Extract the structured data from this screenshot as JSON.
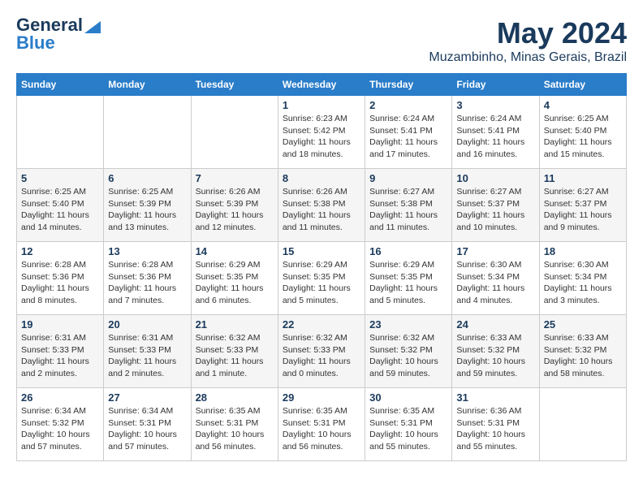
{
  "logo": {
    "general": "General",
    "blue": "Blue"
  },
  "title": "May 2024",
  "location": "Muzambinho, Minas Gerais, Brazil",
  "days_of_week": [
    "Sunday",
    "Monday",
    "Tuesday",
    "Wednesday",
    "Thursday",
    "Friday",
    "Saturday"
  ],
  "weeks": [
    [
      {
        "day": "",
        "info": ""
      },
      {
        "day": "",
        "info": ""
      },
      {
        "day": "",
        "info": ""
      },
      {
        "day": "1",
        "info": "Sunrise: 6:23 AM\nSunset: 5:42 PM\nDaylight: 11 hours and 18 minutes."
      },
      {
        "day": "2",
        "info": "Sunrise: 6:24 AM\nSunset: 5:41 PM\nDaylight: 11 hours and 17 minutes."
      },
      {
        "day": "3",
        "info": "Sunrise: 6:24 AM\nSunset: 5:41 PM\nDaylight: 11 hours and 16 minutes."
      },
      {
        "day": "4",
        "info": "Sunrise: 6:25 AM\nSunset: 5:40 PM\nDaylight: 11 hours and 15 minutes."
      }
    ],
    [
      {
        "day": "5",
        "info": "Sunrise: 6:25 AM\nSunset: 5:40 PM\nDaylight: 11 hours and 14 minutes."
      },
      {
        "day": "6",
        "info": "Sunrise: 6:25 AM\nSunset: 5:39 PM\nDaylight: 11 hours and 13 minutes."
      },
      {
        "day": "7",
        "info": "Sunrise: 6:26 AM\nSunset: 5:39 PM\nDaylight: 11 hours and 12 minutes."
      },
      {
        "day": "8",
        "info": "Sunrise: 6:26 AM\nSunset: 5:38 PM\nDaylight: 11 hours and 11 minutes."
      },
      {
        "day": "9",
        "info": "Sunrise: 6:27 AM\nSunset: 5:38 PM\nDaylight: 11 hours and 11 minutes."
      },
      {
        "day": "10",
        "info": "Sunrise: 6:27 AM\nSunset: 5:37 PM\nDaylight: 11 hours and 10 minutes."
      },
      {
        "day": "11",
        "info": "Sunrise: 6:27 AM\nSunset: 5:37 PM\nDaylight: 11 hours and 9 minutes."
      }
    ],
    [
      {
        "day": "12",
        "info": "Sunrise: 6:28 AM\nSunset: 5:36 PM\nDaylight: 11 hours and 8 minutes."
      },
      {
        "day": "13",
        "info": "Sunrise: 6:28 AM\nSunset: 5:36 PM\nDaylight: 11 hours and 7 minutes."
      },
      {
        "day": "14",
        "info": "Sunrise: 6:29 AM\nSunset: 5:35 PM\nDaylight: 11 hours and 6 minutes."
      },
      {
        "day": "15",
        "info": "Sunrise: 6:29 AM\nSunset: 5:35 PM\nDaylight: 11 hours and 5 minutes."
      },
      {
        "day": "16",
        "info": "Sunrise: 6:29 AM\nSunset: 5:35 PM\nDaylight: 11 hours and 5 minutes."
      },
      {
        "day": "17",
        "info": "Sunrise: 6:30 AM\nSunset: 5:34 PM\nDaylight: 11 hours and 4 minutes."
      },
      {
        "day": "18",
        "info": "Sunrise: 6:30 AM\nSunset: 5:34 PM\nDaylight: 11 hours and 3 minutes."
      }
    ],
    [
      {
        "day": "19",
        "info": "Sunrise: 6:31 AM\nSunset: 5:33 PM\nDaylight: 11 hours and 2 minutes."
      },
      {
        "day": "20",
        "info": "Sunrise: 6:31 AM\nSunset: 5:33 PM\nDaylight: 11 hours and 2 minutes."
      },
      {
        "day": "21",
        "info": "Sunrise: 6:32 AM\nSunset: 5:33 PM\nDaylight: 11 hours and 1 minute."
      },
      {
        "day": "22",
        "info": "Sunrise: 6:32 AM\nSunset: 5:33 PM\nDaylight: 11 hours and 0 minutes."
      },
      {
        "day": "23",
        "info": "Sunrise: 6:32 AM\nSunset: 5:32 PM\nDaylight: 10 hours and 59 minutes."
      },
      {
        "day": "24",
        "info": "Sunrise: 6:33 AM\nSunset: 5:32 PM\nDaylight: 10 hours and 59 minutes."
      },
      {
        "day": "25",
        "info": "Sunrise: 6:33 AM\nSunset: 5:32 PM\nDaylight: 10 hours and 58 minutes."
      }
    ],
    [
      {
        "day": "26",
        "info": "Sunrise: 6:34 AM\nSunset: 5:32 PM\nDaylight: 10 hours and 57 minutes."
      },
      {
        "day": "27",
        "info": "Sunrise: 6:34 AM\nSunset: 5:31 PM\nDaylight: 10 hours and 57 minutes."
      },
      {
        "day": "28",
        "info": "Sunrise: 6:35 AM\nSunset: 5:31 PM\nDaylight: 10 hours and 56 minutes."
      },
      {
        "day": "29",
        "info": "Sunrise: 6:35 AM\nSunset: 5:31 PM\nDaylight: 10 hours and 56 minutes."
      },
      {
        "day": "30",
        "info": "Sunrise: 6:35 AM\nSunset: 5:31 PM\nDaylight: 10 hours and 55 minutes."
      },
      {
        "day": "31",
        "info": "Sunrise: 6:36 AM\nSunset: 5:31 PM\nDaylight: 10 hours and 55 minutes."
      },
      {
        "day": "",
        "info": ""
      }
    ]
  ]
}
